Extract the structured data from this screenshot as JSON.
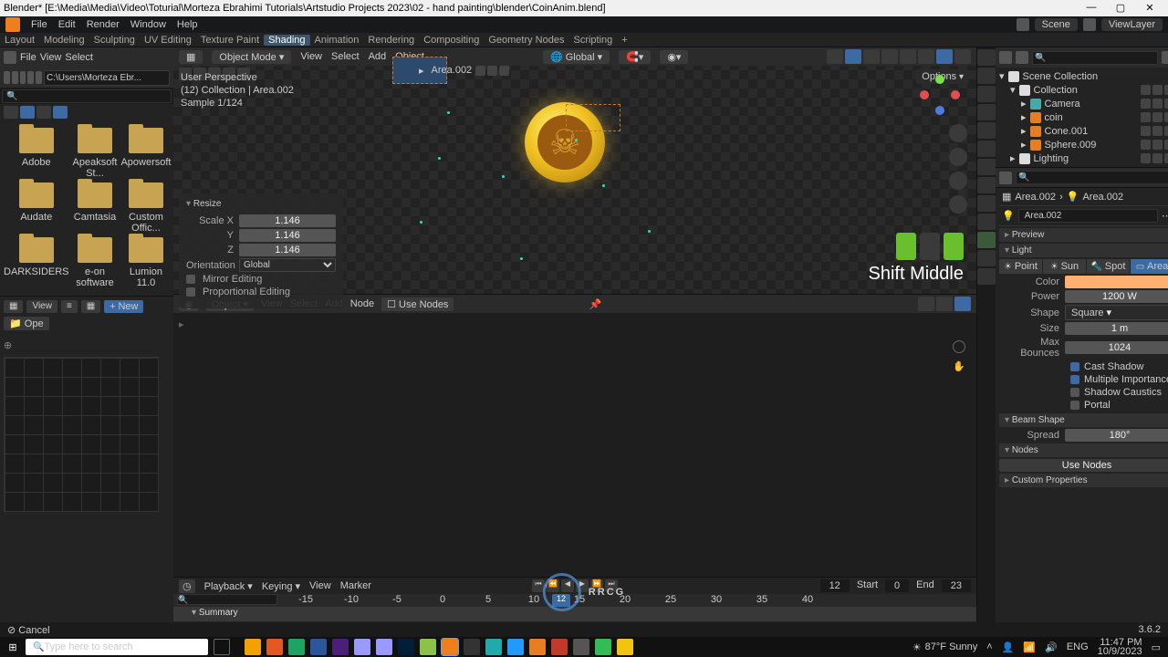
{
  "window": {
    "title": "Blender* [E:\\Media\\Media\\Video\\Toturial\\Morteza Ebrahimi Tutorials\\Artstudio Projects 2023\\02 - hand painting\\blender\\CoinAnim.blend]"
  },
  "menubar": {
    "items": [
      "File",
      "Edit",
      "Render",
      "Window",
      "Help"
    ],
    "scene_label": "Scene",
    "viewlayer_label": "ViewLayer"
  },
  "workspaces": {
    "tabs": [
      "Layout",
      "Modeling",
      "Sculpting",
      "UV Editing",
      "Texture Paint",
      "Shading",
      "Animation",
      "Rendering",
      "Compositing",
      "Geometry Nodes",
      "Scripting"
    ],
    "active": "Shading"
  },
  "filebrowser": {
    "hdr": {
      "items": [
        "File",
        "View",
        "Select"
      ]
    },
    "path_value": "C:\\Users\\Morteza Ebr...",
    "search_placeholder": "",
    "folders": [
      "Adobe",
      "Apeaksoft St...",
      "Apowersoft",
      "Audate",
      "Camtasia",
      "Custom Offic...",
      "DARKSIDERS",
      "e-on software",
      "Lumion 11.0"
    ]
  },
  "imgedit": {
    "btns": [
      "View",
      "+",
      "New",
      "Ope"
    ]
  },
  "viewport": {
    "mode": "Object Mode",
    "menus": [
      "View",
      "Select",
      "Add",
      "Object"
    ],
    "global": "Global",
    "info": {
      "persp": "User Perspective",
      "coll": "(12) Collection | Area.002",
      "sample": "Sample 1/124"
    },
    "panel": {
      "title": "Resize",
      "scale_x": "1.146",
      "scale_y": "1.146",
      "scale_z": "1.146",
      "orientation": "Global",
      "mirror": "Mirror Editing",
      "prop": "Proportional Editing"
    },
    "keyhint": "Shift Middle",
    "options_label": "Options"
  },
  "shader": {
    "type": "Object",
    "menus": [
      "View",
      "Select",
      "Add",
      "Node"
    ],
    "usenodes": "Use Nodes"
  },
  "timeline": {
    "menus": [
      "Playback",
      "Keying",
      "View",
      "Marker"
    ],
    "cur": "12",
    "start_lbl": "Start",
    "start": "0",
    "end_lbl": "End",
    "end": "23",
    "ticks": [
      "-15",
      "-10",
      "-5",
      "0",
      "5",
      "10",
      "15",
      "20",
      "25",
      "30",
      "35",
      "40"
    ],
    "summary": "Summary",
    "cursor_frame": "12"
  },
  "outliner": {
    "root": "Scene Collection",
    "collection": "Collection",
    "items": [
      "Area.002",
      "Camera",
      "coin",
      "Cone.001",
      "Sphere.009",
      "Lighting"
    ]
  },
  "props": {
    "crumb1": "Area.002",
    "crumb2": "Area.002",
    "block": "Area.002",
    "sec_preview": "Preview",
    "sec_light": "Light",
    "light_tabs": [
      "Point",
      "Sun",
      "Spot",
      "Area"
    ],
    "light_active": "Area",
    "color_lbl": "Color",
    "power_lbl": "Power",
    "power": "1200 W",
    "shape_lbl": "Shape",
    "shape": "Square",
    "size_lbl": "Size",
    "size": "1 m",
    "maxb_lbl": "Max Bounces",
    "maxb": "1024",
    "castshadow": "Cast Shadow",
    "multimp": "Multiple Importance",
    "caustics": "Shadow Caustics",
    "portal": "Portal",
    "sec_beam": "Beam Shape",
    "spread_lbl": "Spread",
    "spread": "180°",
    "sec_nodes": "Nodes",
    "use_nodes_btn": "Use Nodes",
    "sec_custom": "Custom Properties"
  },
  "status": {
    "left": "⊘  Cancel",
    "right": "3.6.2"
  },
  "taskbar": {
    "search_placeholder": "Type here to search",
    "weather": "87°F Sunny",
    "time": "11:47 PM",
    "date": "10/9/2023",
    "lang": "ENG"
  },
  "watermark": "RRCG"
}
